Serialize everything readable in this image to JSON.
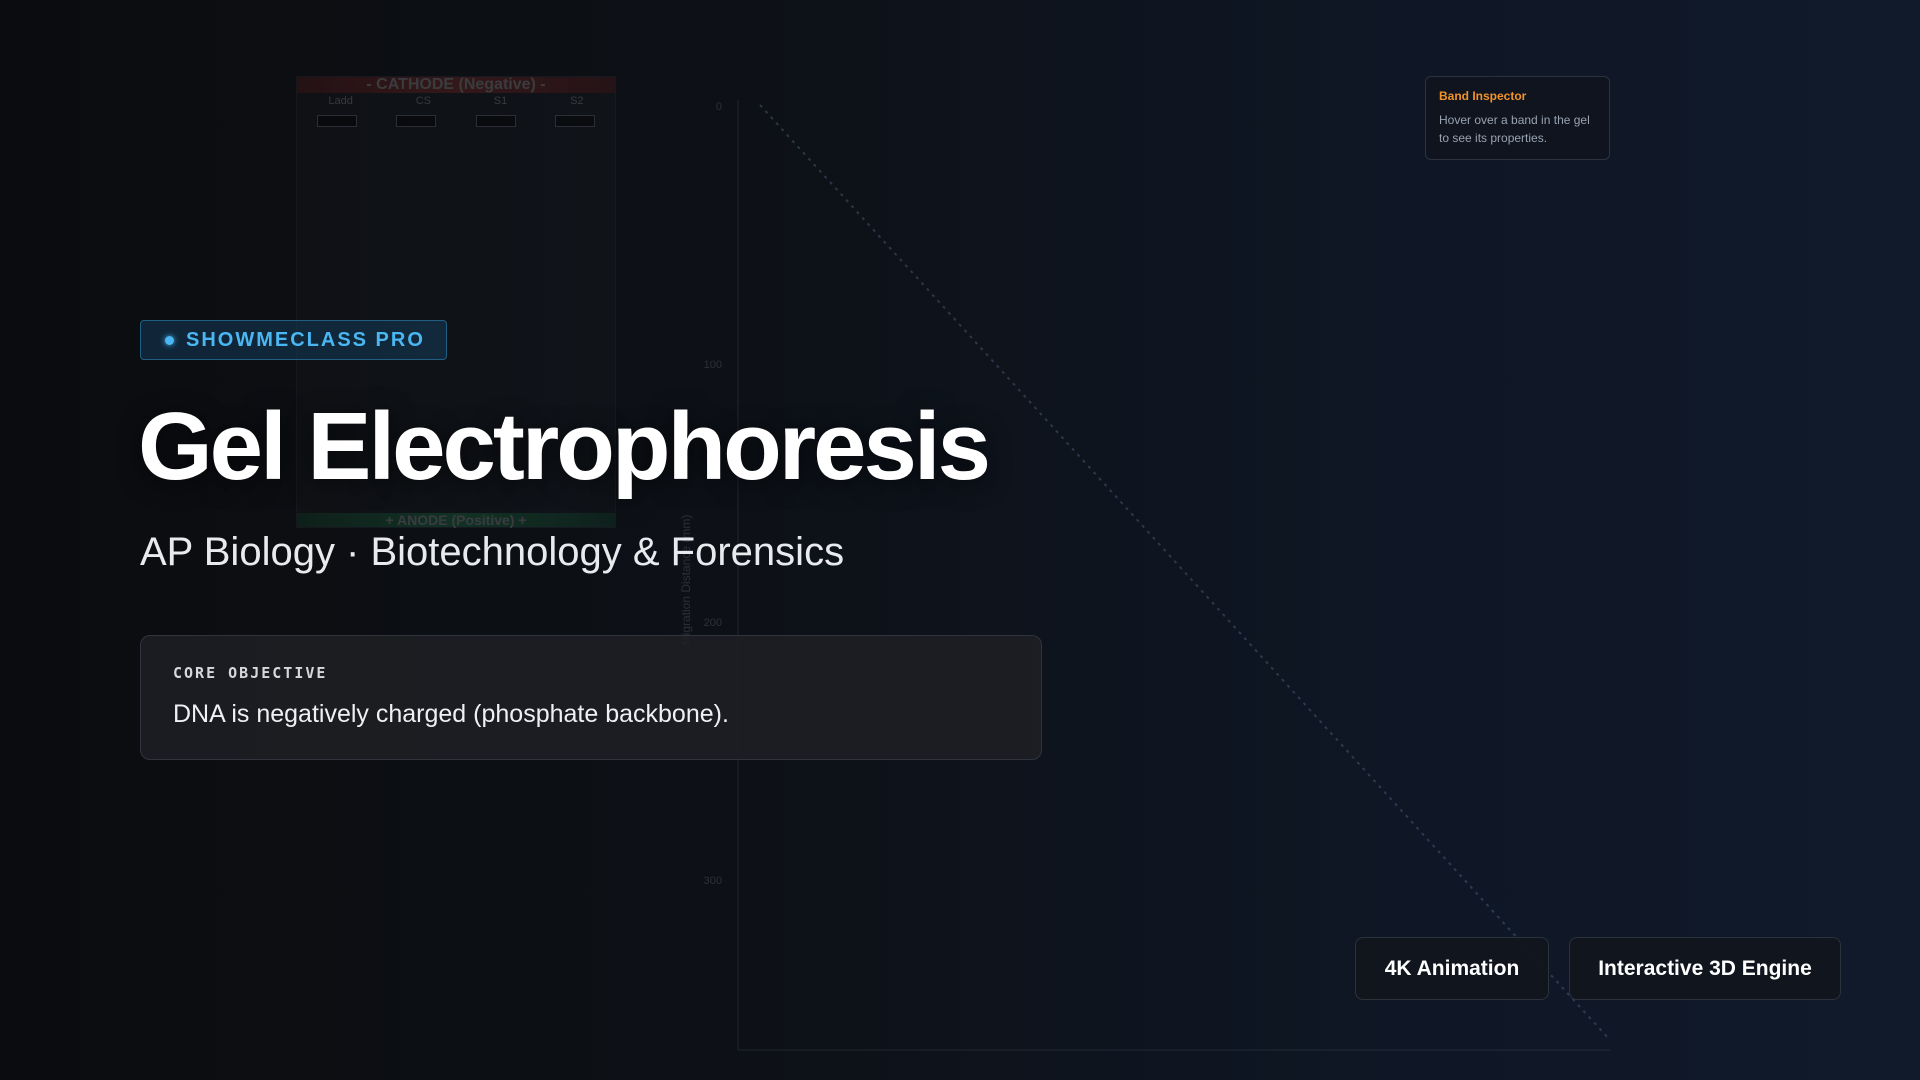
{
  "background": {
    "gel": {
      "cathode_label": "- CATHODE (Negative) -",
      "anode_label": "+ ANODE (Positive) +",
      "lanes": [
        "Ladd",
        "CS",
        "S1",
        "S2"
      ]
    },
    "chart": {
      "ytick_labels": [
        "0",
        "100",
        "200",
        "300"
      ],
      "ylabel": "Migration Distance (mm)"
    }
  },
  "badge": {
    "label": "SHOWMECLASS PRO",
    "color": "#4ab6f2"
  },
  "hero": {
    "title": "Gel Electrophoresis",
    "subtitle": "AP Biology · Biotechnology & Forensics"
  },
  "objective": {
    "label": "CORE OBJECTIVE",
    "text": "DNA is negatively charged (phosphate backbone)."
  },
  "inspector": {
    "title": "Band Inspector",
    "text": "Hover over a band in the gel to see its properties.",
    "accent": "#f0932b"
  },
  "features": {
    "animation_label": "4K Animation",
    "engine_label": "Interactive 3D Engine"
  }
}
